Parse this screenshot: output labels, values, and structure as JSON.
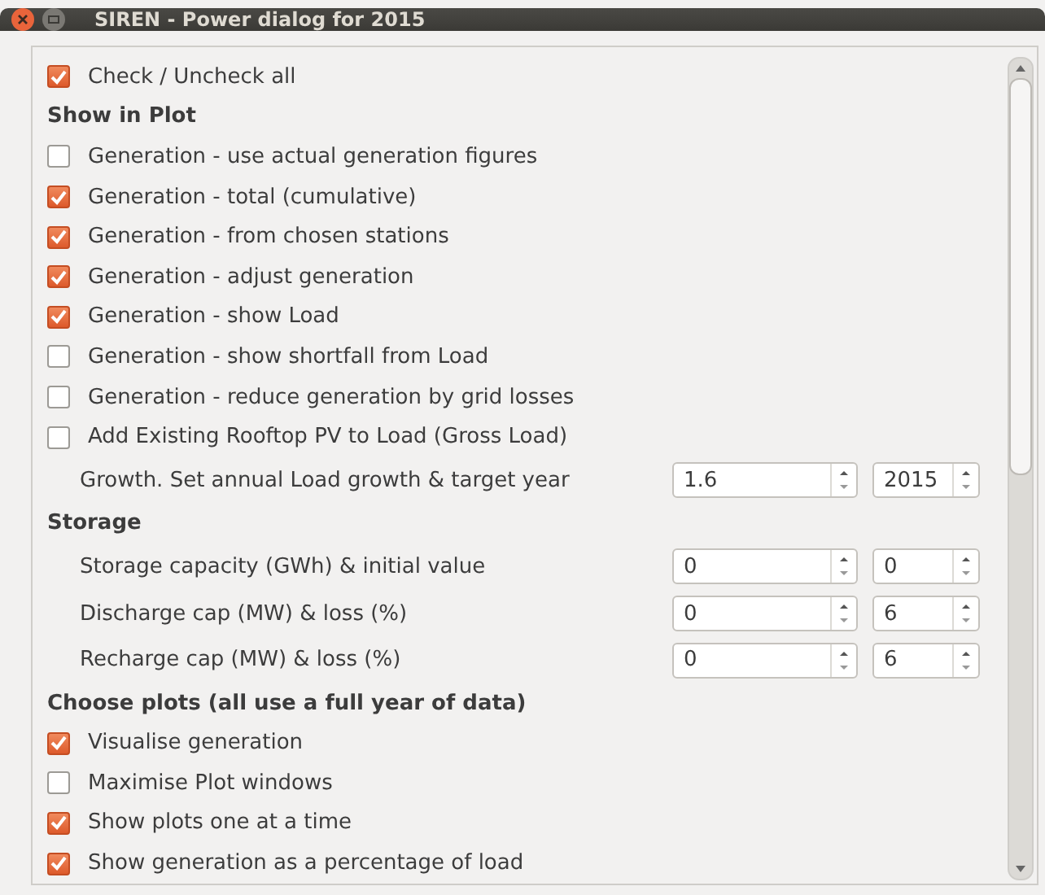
{
  "window": {
    "title": "SIREN - Power dialog for 2015"
  },
  "items": [
    {
      "kind": "checkbox",
      "label": "Check / Uncheck all",
      "checked": true
    },
    {
      "kind": "heading",
      "label": "Show in Plot"
    },
    {
      "kind": "checkbox",
      "label": "Generation - use actual generation figures",
      "checked": false
    },
    {
      "kind": "checkbox",
      "label": "Generation - total (cumulative)",
      "checked": true
    },
    {
      "kind": "checkbox",
      "label": "Generation - from chosen stations",
      "checked": true
    },
    {
      "kind": "checkbox",
      "label": "Generation - adjust generation",
      "checked": true
    },
    {
      "kind": "checkbox",
      "label": "Generation - show Load",
      "checked": true
    },
    {
      "kind": "checkbox",
      "label": "Generation - show shortfall from Load",
      "checked": false
    },
    {
      "kind": "checkbox",
      "label": "Generation - reduce generation by grid losses",
      "checked": false
    },
    {
      "kind": "checkbox",
      "label": "Add Existing Rooftop PV to Load (Gross Load)",
      "checked": false
    },
    {
      "kind": "spin",
      "label": "Growth. Set annual Load growth & target year",
      "values": [
        "1.6",
        "2015"
      ]
    },
    {
      "kind": "heading",
      "label": "Storage"
    },
    {
      "kind": "spin",
      "label": "Storage capacity (GWh) & initial value",
      "values": [
        "0",
        "0"
      ]
    },
    {
      "kind": "spin",
      "label": "Discharge cap (MW) & loss (%)",
      "values": [
        "0",
        "6"
      ]
    },
    {
      "kind": "spin",
      "label": "Recharge cap (MW) & loss (%)",
      "values": [
        "0",
        "6"
      ]
    },
    {
      "kind": "heading",
      "label": "Choose plots (all use a full year of data)"
    },
    {
      "kind": "checkbox",
      "label": "Visualise generation",
      "checked": true
    },
    {
      "kind": "checkbox",
      "label": "Maximise Plot windows",
      "checked": false
    },
    {
      "kind": "checkbox",
      "label": "Show plots one at a time",
      "checked": true
    },
    {
      "kind": "checkbox",
      "label": "Show generation as a percentage of load",
      "checked": true
    }
  ]
}
